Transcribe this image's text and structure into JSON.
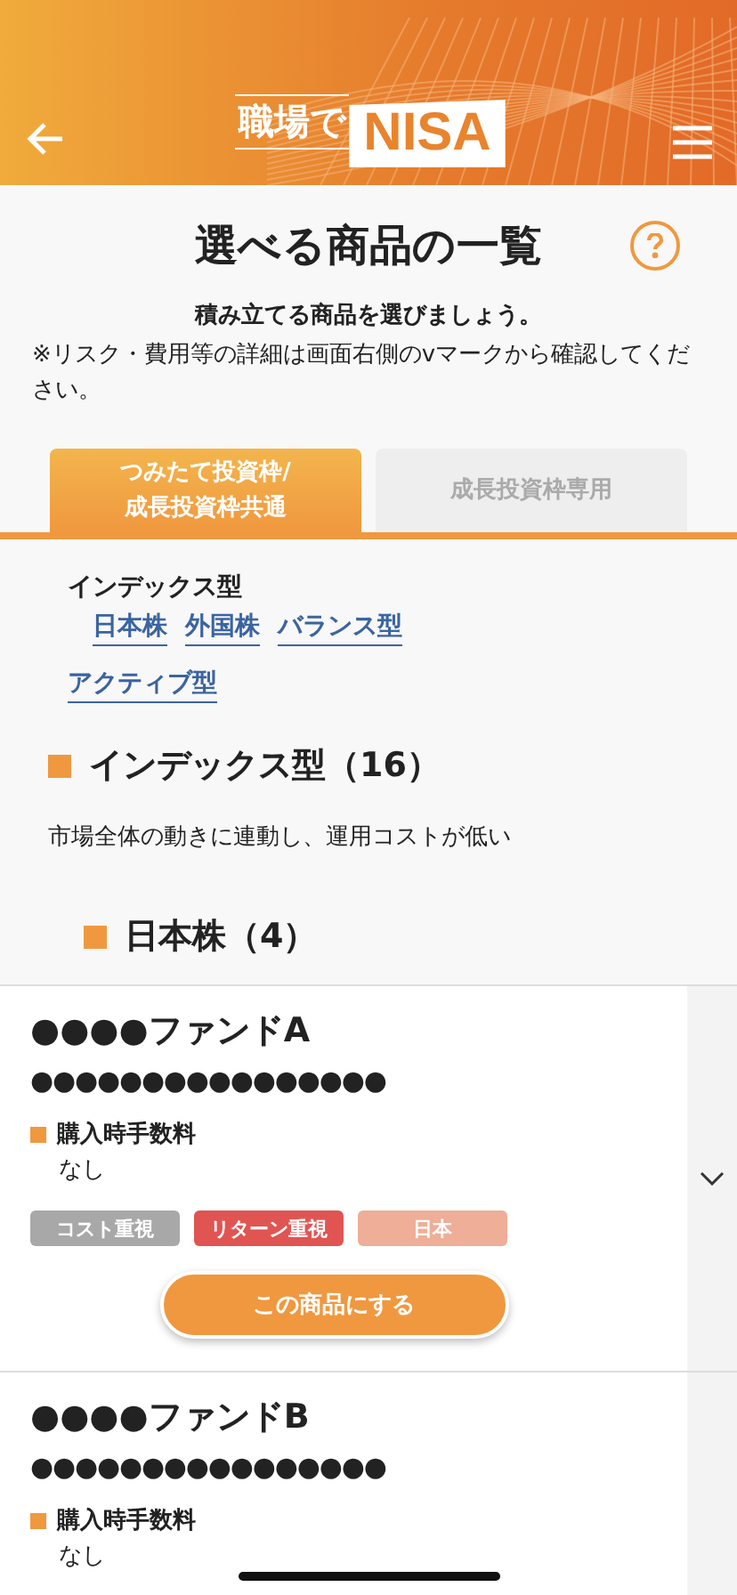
{
  "header": {
    "logo": {
      "prefix": "職場で",
      "main": "NISA"
    }
  },
  "page": {
    "title": "選べる商品の一覧",
    "lead": "積み立てる商品を選びましょう。",
    "note": "※リスク・費用等の詳細は画面右側のvマークから確認してください。"
  },
  "tabs": [
    {
      "label": "つみたて投資枠/\n成長投資枠共通",
      "selected": true
    },
    {
      "label": "成長投資枠専用",
      "selected": false
    }
  ],
  "categories": {
    "group": "インデックス型",
    "links": [
      "日本株",
      "外国株",
      "バランス型"
    ],
    "other_link": "アクティブ型"
  },
  "section": {
    "title": "インデックス型（16）",
    "description": "市場全体の動きに連動し、運用コストが低い",
    "subtitle": "日本株（4）"
  },
  "funds": [
    {
      "name": "●●●●ファンドA",
      "subname": "●●●●●●●●●●●●●●●●",
      "fee_label": "購入時手数料",
      "fee": "なし",
      "tags": [
        {
          "label": "コスト重視",
          "color": "#a8a8a8"
        },
        {
          "label": "リターン重視",
          "color": "#e05552"
        },
        {
          "label": "日本",
          "color": "#eeae97"
        }
      ],
      "button": "この商品にする"
    },
    {
      "name": "●●●●ファンドB",
      "subname": "●●●●●●●●●●●●●●●●",
      "fee_label": "購入時手数料",
      "fee": "なし"
    }
  ]
}
